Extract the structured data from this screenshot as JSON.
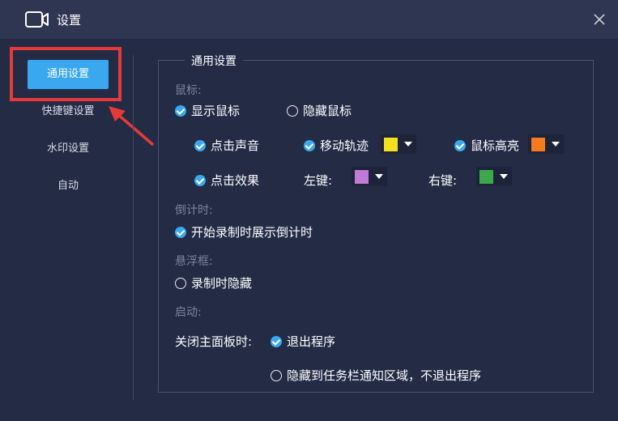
{
  "window": {
    "title": "设置"
  },
  "sidebar": {
    "items": [
      {
        "label": "通用设置",
        "active": true
      },
      {
        "label": "快捷键设置"
      },
      {
        "label": "水印设置"
      },
      {
        "label": "自动"
      }
    ]
  },
  "general": {
    "title": "通用设置",
    "mouse": {
      "label": "鼠标:",
      "show_mouse": "显示鼠标",
      "hide_mouse": "隐藏鼠标",
      "click_sound": "点击声音",
      "move_trail": "移动轨迹",
      "highlight": "鼠标高亮",
      "click_effect": "点击效果",
      "left_key": "左键:",
      "right_key": "右键:",
      "colors": {
        "trail": "#f5e020",
        "highlight": "#f57a20",
        "left": "#c07ad8",
        "right": "#3da84a"
      }
    },
    "countdown": {
      "label": "倒计时:",
      "show_countdown": "开始录制时展示倒计时"
    },
    "float_box": {
      "label": "悬浮框:",
      "hide_when_recording": "录制时隐藏"
    },
    "startup": {
      "label": "启动:",
      "close_panel": "关闭主面板时:",
      "exit_program": "退出程序",
      "hide_to_tray": "隐藏到任务栏通知区域，不退出程序"
    }
  },
  "accent_color": "#3aa8ef",
  "annotation_color": "#e63a3a"
}
